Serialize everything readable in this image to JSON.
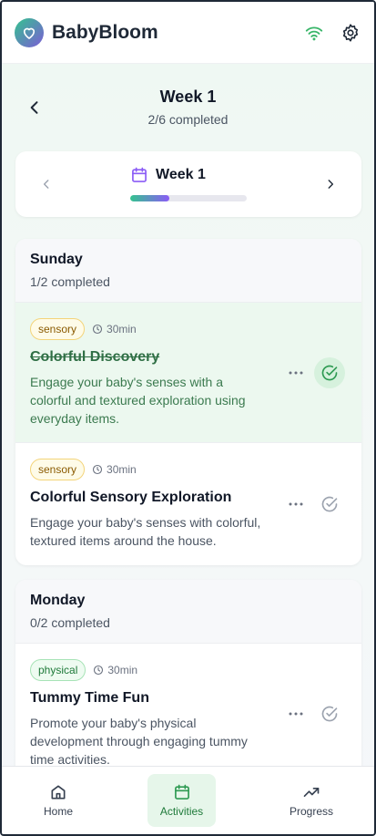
{
  "app": {
    "title": "BabyBloom"
  },
  "header": {
    "title": "Week 1",
    "subtitle": "2/6 completed"
  },
  "week_selector": {
    "label": "Week 1",
    "progress_fraction": 0.333
  },
  "days": [
    {
      "name": "Sunday",
      "completed": "1/2 completed",
      "activities": [
        {
          "category": "sensory",
          "duration": "30min",
          "title": "Colorful Discovery",
          "description": "Engage your baby's senses with a colorful and textured exploration using everyday items.",
          "done": true
        },
        {
          "category": "sensory",
          "duration": "30min",
          "title": "Colorful Sensory Exploration",
          "description": "Engage your baby's senses with colorful, textured items around the house.",
          "done": false
        }
      ]
    },
    {
      "name": "Monday",
      "completed": "0/2 completed",
      "activities": [
        {
          "category": "physical",
          "duration": "30min",
          "title": "Tummy Time Fun",
          "description": "Promote your baby's physical development through engaging tummy time activities.",
          "done": false
        }
      ]
    }
  ],
  "nav": {
    "home": "Home",
    "activities": "Activities",
    "progress": "Progress",
    "active": "activities"
  },
  "icons": [
    "heart-icon",
    "wifi-icon",
    "gear-icon",
    "chevron-left-icon",
    "chevron-right-icon",
    "calendar-icon",
    "clock-icon",
    "more-icon",
    "check-circle-icon",
    "home-icon",
    "trending-up-icon"
  ],
  "colors": {
    "accent_green": "#34c38f",
    "accent_purple": "#8b5cf6",
    "done_bg": "#ecf8ef",
    "active_nav": "#e6f6ea"
  }
}
